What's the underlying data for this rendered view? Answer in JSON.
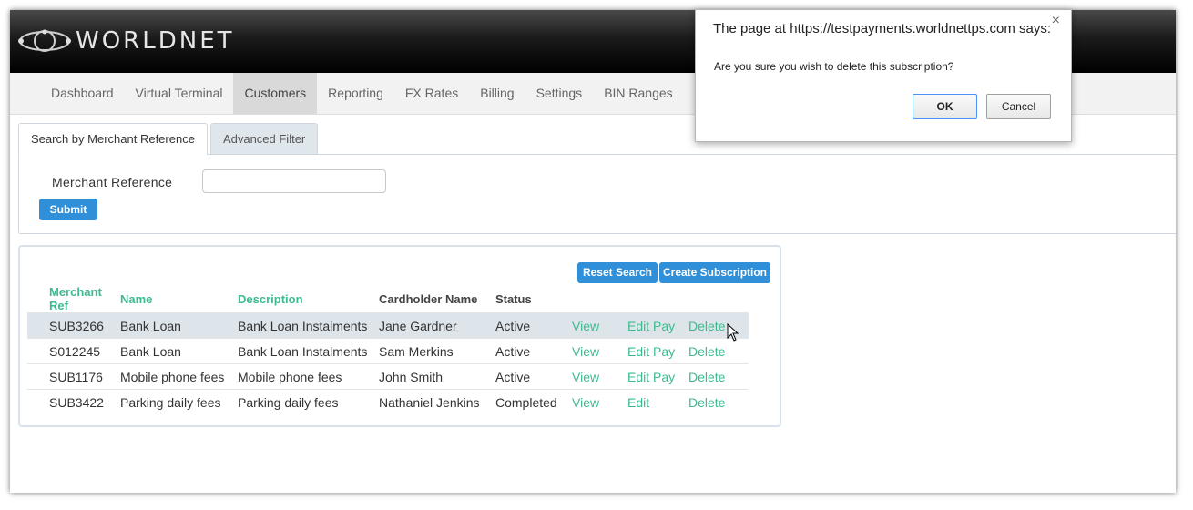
{
  "app": {
    "logo_text": "WORLDNET"
  },
  "nav": {
    "items": [
      {
        "label": "Dashboard"
      },
      {
        "label": "Virtual Terminal"
      },
      {
        "label": "Customers"
      },
      {
        "label": "Reporting"
      },
      {
        "label": "FX Rates"
      },
      {
        "label": "Billing"
      },
      {
        "label": "Settings"
      },
      {
        "label": "BIN Ranges"
      }
    ],
    "active": "Customers"
  },
  "search": {
    "tabs": [
      {
        "label": "Search by Merchant Reference"
      },
      {
        "label": "Advanced Filter"
      }
    ],
    "field_label": "Merchant Reference",
    "field_value": "",
    "submit_label": "Submit"
  },
  "results": {
    "reset_label": "Reset Search",
    "create_label": "Create Subscription",
    "columns": [
      "Merchant Ref",
      "Name",
      "Description",
      "Cardholder Name",
      "Status"
    ],
    "rows": [
      {
        "ref": "SUB3266",
        "name": "Bank Loan",
        "description": "Bank Loan Instalments",
        "cardholder": "Jane Gardner",
        "status": "Active",
        "view": "View",
        "edit": "Edit",
        "pay": "Pay",
        "delete": "Delete"
      },
      {
        "ref": "S012245",
        "name": "Bank Loan",
        "description": "Bank Loan Instalments",
        "cardholder": "Sam Merkins",
        "status": "Active",
        "view": "View",
        "edit": "Edit",
        "pay": "Pay",
        "delete": "Delete"
      },
      {
        "ref": "SUB1176",
        "name": "Mobile phone fees",
        "description": "Mobile phone fees",
        "cardholder": "John Smith",
        "status": "Active",
        "view": "View",
        "edit": "Edit",
        "pay": "Pay",
        "delete": "Delete"
      },
      {
        "ref": "SUB3422",
        "name": "Parking daily fees",
        "description": "Parking daily fees",
        "cardholder": "Nathaniel Jenkins",
        "status": "Completed",
        "view": "View",
        "edit": "Edit",
        "pay": "",
        "delete": "Delete"
      }
    ]
  },
  "dialog": {
    "title": "The page at https://testpayments.worldnettps.com says:",
    "message": "Are you sure you wish to delete this subscription?",
    "ok_label": "OK",
    "cancel_label": "Cancel",
    "close_glyph": "×"
  },
  "colors": {
    "accent_green": "#3dbb8f",
    "button_blue": "#2f8fd8",
    "highlight_row": "#dde4ea"
  }
}
